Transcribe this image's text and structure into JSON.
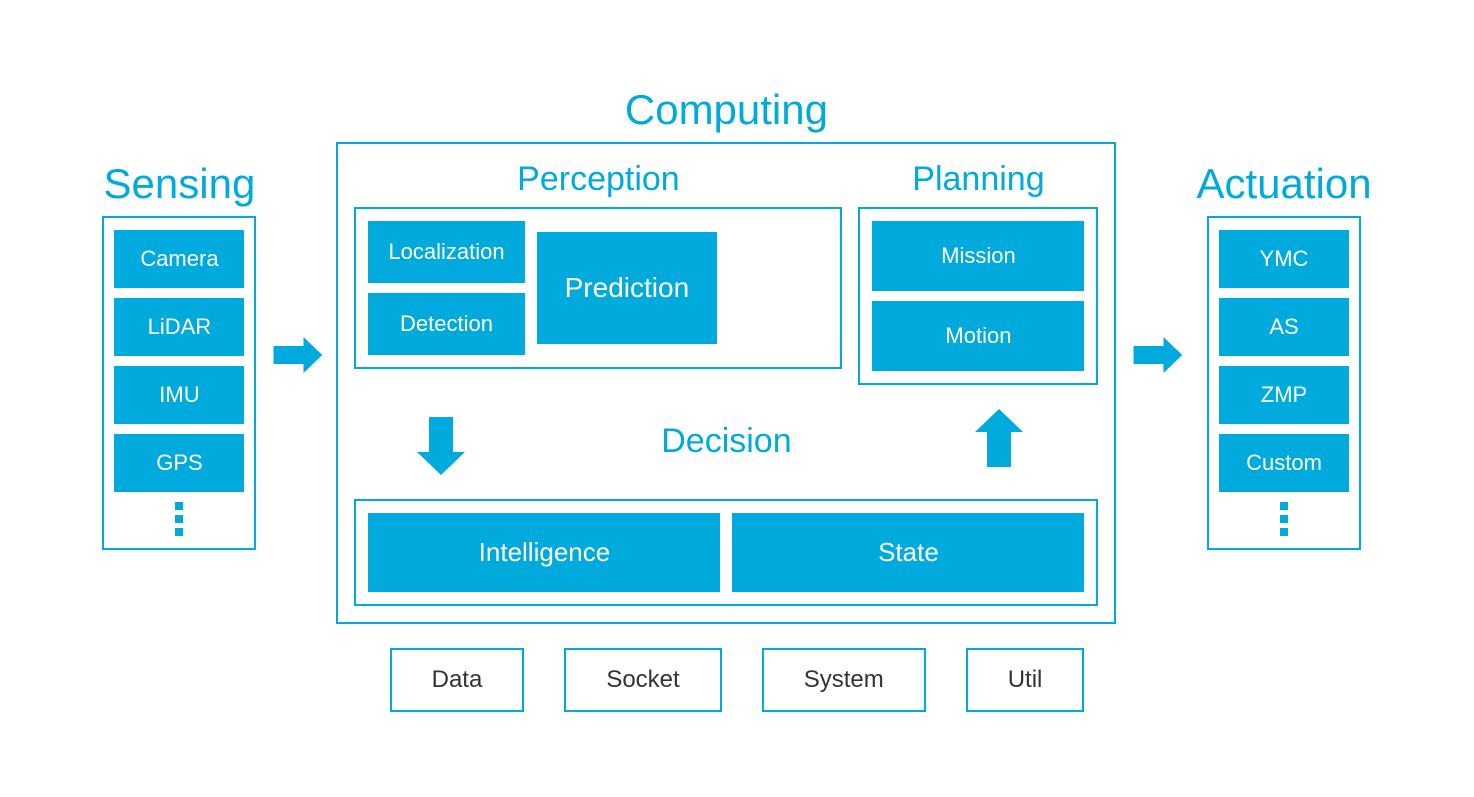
{
  "sections": {
    "sensing_title": "Sensing",
    "computing_title": "Computing",
    "actuation_title": "Actuation"
  },
  "sensing": {
    "items": [
      "Camera",
      "LiDAR",
      "IMU",
      "GPS"
    ]
  },
  "computing": {
    "perception_title": "Perception",
    "planning_title": "Planning",
    "decision_title": "Decision",
    "localization_label": "Localization",
    "detection_label": "Detection",
    "prediction_label": "Prediction",
    "mission_label": "Mission",
    "motion_label": "Motion",
    "intelligence_label": "Intelligence",
    "state_label": "State"
  },
  "actuation": {
    "items": [
      "YMC",
      "AS",
      "ZMP",
      "Custom"
    ]
  },
  "bottom": {
    "items": [
      "Data",
      "Socket",
      "System",
      "Util"
    ]
  },
  "colors": {
    "accent": "#00aadd",
    "white": "#ffffff",
    "dark": "#333333"
  }
}
